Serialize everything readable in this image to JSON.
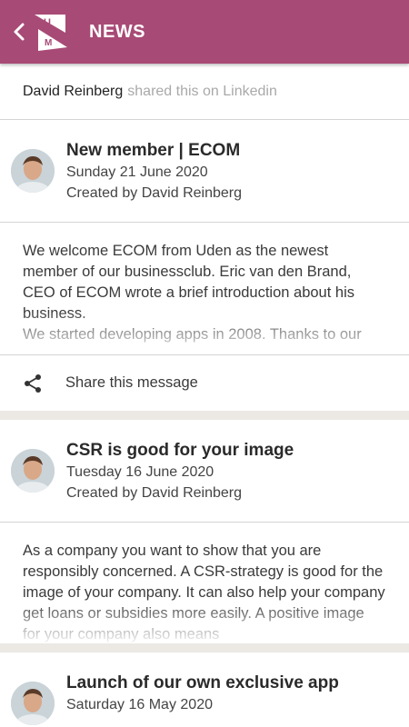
{
  "header": {
    "title": "NEWS",
    "back_icon": "chevron-left-icon",
    "logo_text": "UM",
    "bg_color": "#a84a76"
  },
  "shared": {
    "name": "David Reinberg",
    "rest": "shared this on Linkedin"
  },
  "posts": [
    {
      "title": "New member | ECOM",
      "date": "Sunday 21 June 2020",
      "author": "Created by David Reinberg",
      "body": "We welcome ECOM from Uden as the newest member of our businessclub. Eric van den Brand, CEO of ECOM wrote a brief introduction about his business.",
      "body_more": "We started developing apps in 2008. Thanks to our",
      "share_label": "Share this message"
    },
    {
      "title": "CSR is good for your image",
      "date": "Tuesday 16 June 2020",
      "author": "Created by David Reinberg",
      "body": "As a company you want to show that you are responsibly concerned. A CSR-strategy is good for the image of your company. It can also help your company get loans or subsidies more easily. A positive image for your company also means"
    },
    {
      "title": "Launch of our own exclusive app",
      "date": "Saturday 16 May 2020"
    }
  ]
}
